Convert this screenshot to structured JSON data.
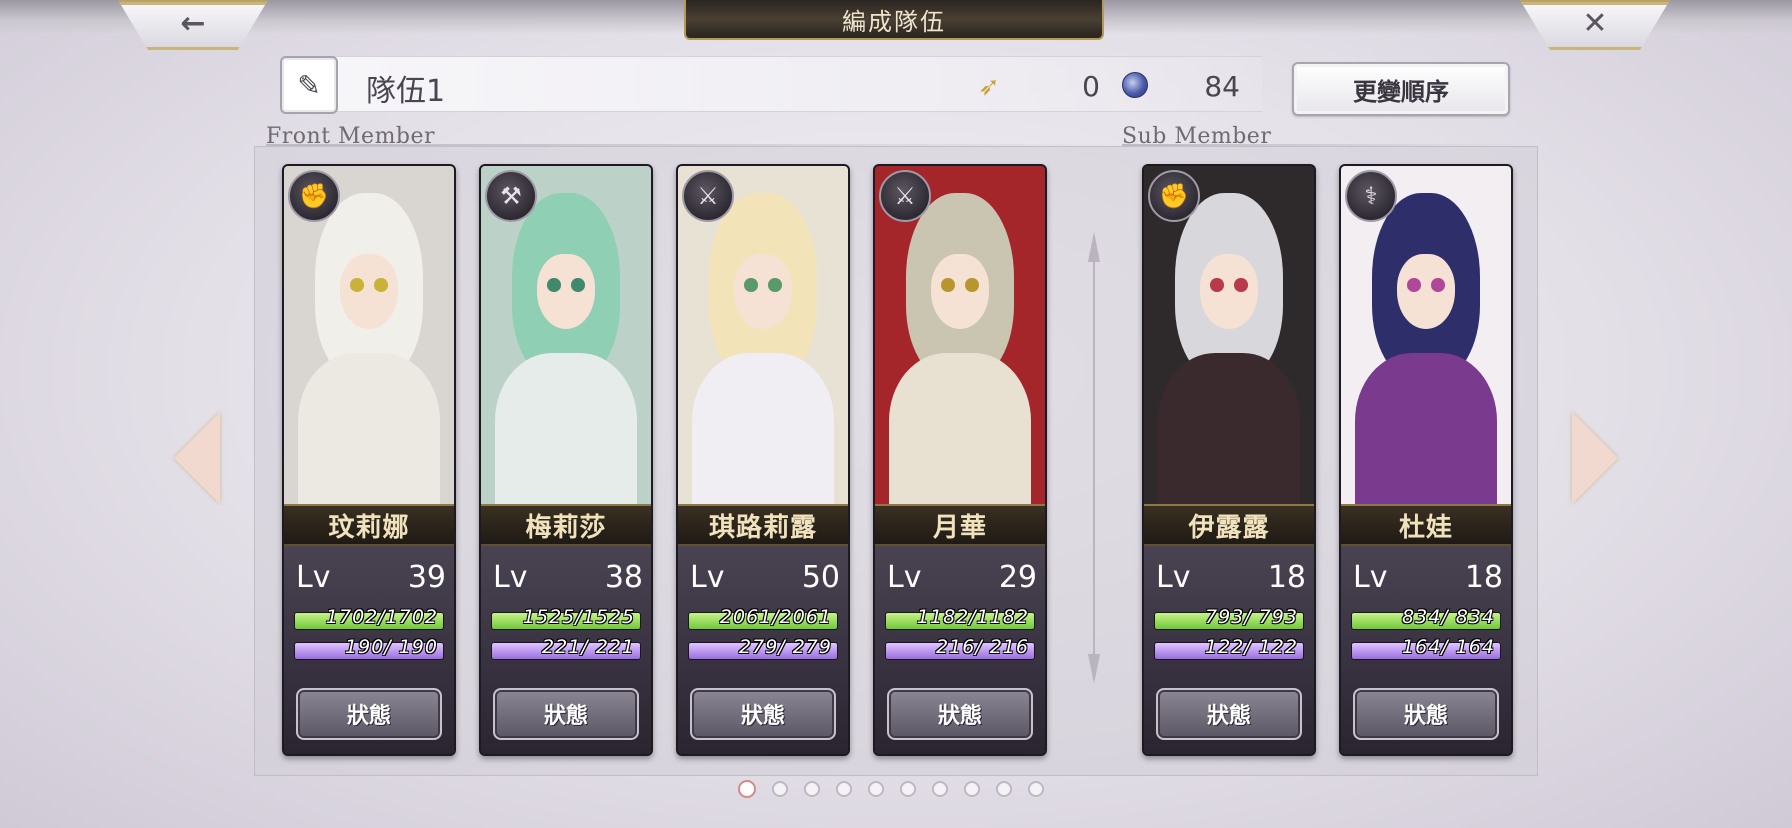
{
  "header": {
    "back_glyph": "←",
    "close_glyph": "✕",
    "title": "編成隊伍"
  },
  "team": {
    "name": "隊伍1",
    "wing_value": "0",
    "orb_value": "84",
    "order_button": "更變順序"
  },
  "sections": {
    "front_label": "Front Member",
    "sub_label": "Sub Member"
  },
  "members": [
    {
      "name": "玟莉娜",
      "lv_label": "Lv",
      "lv": "39",
      "hp": "1702/1702",
      "mp": "190/ 190",
      "status": "狀態",
      "weapon_icon": "gauntlet-icon",
      "colors": {
        "hair": "#f1efe9",
        "eye": "#c9b23a",
        "body": "#ece8e2",
        "bg": "#d9d6d2"
      }
    },
    {
      "name": "梅莉莎",
      "lv_label": "Lv",
      "lv": "38",
      "hp": "1525/1525",
      "mp": "221/ 221",
      "status": "狀態",
      "weapon_icon": "axe-icon",
      "colors": {
        "hair": "#8fcfb4",
        "eye": "#3f8a6c",
        "body": "#e6ece9",
        "bg": "#bcd2c8"
      }
    },
    {
      "name": "琪路莉露",
      "lv_label": "Lv",
      "lv": "50",
      "hp": "2061/2061",
      "mp": "279/ 279",
      "status": "狀態",
      "weapon_icon": "sword-icon",
      "colors": {
        "hair": "#f2e4b8",
        "eye": "#5a9a6a",
        "body": "#f0eef2",
        "bg": "#e8e2d4"
      }
    },
    {
      "name": "月華",
      "lv_label": "Lv",
      "lv": "29",
      "hp": "1182/1182",
      "mp": "216/ 216",
      "status": "狀態",
      "weapon_icon": "blade-icon",
      "colors": {
        "hair": "#c9c5b0",
        "eye": "#b8962e",
        "body": "#e8e1d2",
        "bg": "#a5262a"
      }
    },
    {
      "name": "伊露露",
      "lv_label": "Lv",
      "lv": "18",
      "hp": "793/ 793",
      "mp": "122/ 122",
      "status": "狀態",
      "weapon_icon": "gauntlet-icon",
      "colors": {
        "hair": "#d8d8dc",
        "eye": "#b83a4a",
        "body": "#3a2a2e",
        "bg": "#2e2a2c"
      }
    },
    {
      "name": "杜娃",
      "lv_label": "Lv",
      "lv": "18",
      "hp": "834/ 834",
      "mp": "164/ 164",
      "status": "狀態",
      "weapon_icon": "staff-icon",
      "colors": {
        "hair": "#2e2f6a",
        "eye": "#b0489a",
        "body": "#7a3a8e",
        "bg": "#f2eef2"
      }
    }
  ],
  "pagination": {
    "total": 10,
    "current": 1
  },
  "colors": {
    "accent_gold": "#b49a5a",
    "hp_green": "#6fc83a",
    "mp_purple": "#9a6ee0",
    "name_text": "#efe2bd"
  }
}
